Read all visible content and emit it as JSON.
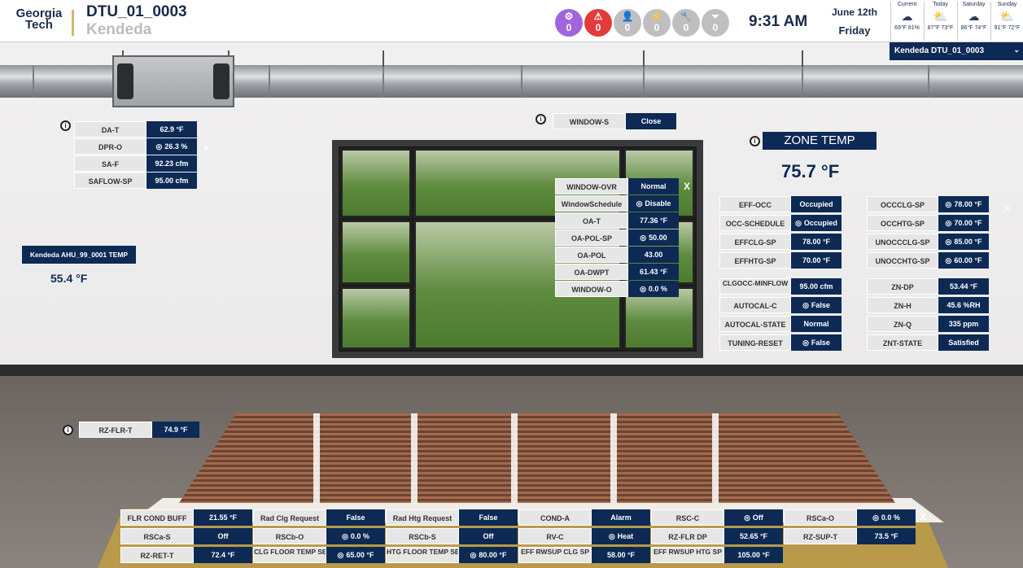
{
  "header": {
    "logo_line1": "Georgia",
    "logo_line2": "Tech",
    "title": "DTU_01_0003",
    "subtitle": "Kendeda",
    "time": "9:31 AM",
    "date": "June 12th",
    "day": "Friday",
    "status": [
      {
        "name": "settings-status",
        "count": "0",
        "color": "#a165d9",
        "icon": "⚙"
      },
      {
        "name": "alarm-status",
        "count": "0",
        "color": "#e33b3b",
        "icon": "⚠"
      },
      {
        "name": "occupancy-status",
        "count": "0",
        "color": "#bfbfbf",
        "icon": "👤"
      },
      {
        "name": "energy-status",
        "count": "0",
        "color": "#bfbfbf",
        "icon": "⚡"
      },
      {
        "name": "maintenance-status",
        "count": "0",
        "color": "#bfbfbf",
        "icon": "🔧"
      },
      {
        "name": "filter-status",
        "count": "0",
        "color": "#bfbfbf",
        "icon": "⏷"
      }
    ],
    "weather": [
      {
        "label": "Current",
        "icon": "☁",
        "temps": "69°F 81%"
      },
      {
        "label": "Today",
        "icon": "⛅",
        "temps": "87°F 73°F"
      },
      {
        "label": "Saturday",
        "icon": "☁",
        "temps": "86°F 74°F"
      },
      {
        "label": "Sunday",
        "icon": "⛅",
        "temps": "91°F 72°F"
      }
    ],
    "building_select": "Kendeda DTU_01_0003"
  },
  "supply": {
    "rows": [
      {
        "label": "DA-T",
        "value": "62.9 °F"
      },
      {
        "label": "DPR-O",
        "value": "26.3 %",
        "settable": true
      },
      {
        "label": "SA-F",
        "value": "92.23 cfm"
      },
      {
        "label": "SAFLOW-SP",
        "value": "95.00 cfm"
      }
    ],
    "close": "x"
  },
  "ahu": {
    "label": "Kendeda AHU_99_0001 TEMP",
    "value": "55.4 °F"
  },
  "window_s": {
    "label": "WINDOW-S",
    "value": "Close"
  },
  "window_panel": {
    "rows": [
      {
        "label": "WINDOW-OVR",
        "value": "Normal"
      },
      {
        "label": "WindowSchedule",
        "value": "Disable",
        "settable": true
      },
      {
        "label": "OA-T",
        "value": "77.36 °F"
      },
      {
        "label": "OA-POL-SP",
        "value": "50.00",
        "settable": true
      },
      {
        "label": "OA-POL",
        "value": "43.00"
      },
      {
        "label": "OA-DWPT",
        "value": "61.43 °F"
      },
      {
        "label": "WINDOW-O",
        "value": "0.0 %",
        "settable": true
      }
    ],
    "close": "X"
  },
  "zone": {
    "title": "ZONE TEMP",
    "value": "75.7 °F",
    "left": [
      {
        "label": "EFF-OCC",
        "value": "Occupied"
      },
      {
        "label": "OCC-SCHEDULE",
        "value": "Occupied",
        "settable": true
      },
      {
        "label": "EFFCLG-SP",
        "value": "78.00 °F"
      },
      {
        "label": "EFFHTG-SP",
        "value": "70.00 °F"
      },
      {
        "label": "CLGOCC-MINFLOW",
        "value": "95.00 cfm",
        "two": true
      },
      {
        "label": "AUTOCAL-C",
        "value": "False",
        "settable": true
      },
      {
        "label": "AUTOCAL-STATE",
        "value": "Normal"
      },
      {
        "label": "TUNING-RESET",
        "value": "False",
        "settable": true
      }
    ],
    "right": [
      {
        "label": "OCCCLG-SP",
        "value": "78.00 °F",
        "settable": true
      },
      {
        "label": "OCCHTG-SP",
        "value": "70.00 °F",
        "settable": true
      },
      {
        "label": "UNOCCCLG-SP",
        "value": "85.00 °F",
        "settable": true
      },
      {
        "label": "UNOCCHTG-SP",
        "value": "60.00 °F",
        "settable": true
      },
      {
        "label": "ZN-DP",
        "value": "53.44 °F"
      },
      {
        "label": "ZN-H",
        "value": "45.6 %RH"
      },
      {
        "label": "ZN-Q",
        "value": "335 ppm"
      },
      {
        "label": "ZNT-STATE",
        "value": "Satisfied"
      }
    ],
    "close": "x"
  },
  "radiant": {
    "label": "RZ-FLR-T",
    "value": "74.9 °F"
  },
  "bottom": {
    "rows": [
      [
        {
          "label": "FLR COND BUFF",
          "value": "21.55 °F"
        },
        {
          "label": "Rad Clg Request",
          "value": "False"
        },
        {
          "label": "Rad Htg Request",
          "value": "False"
        },
        {
          "label": "COND-A",
          "value": "Alarm"
        },
        {
          "label": "RSC-C",
          "value": "Off",
          "settable": true
        },
        {
          "label": "RSCa-O",
          "value": "0.0 %",
          "settable": true
        }
      ],
      [
        {
          "label": "RSCa-S",
          "value": "Off"
        },
        {
          "label": "RSCb-O",
          "value": "0.0 %",
          "settable": true
        },
        {
          "label": "RSCb-S",
          "value": "Off"
        },
        {
          "label": "RV-C",
          "value": "Heat",
          "settable": true
        },
        {
          "label": "RZ-FLR DP",
          "value": "52.65 °F"
        },
        {
          "label": "RZ-SUP-T",
          "value": "73.5 °F"
        }
      ],
      [
        {
          "label": "RZ-RET-T",
          "value": "72.4 °F"
        },
        {
          "label": "CLG FLOOR TEMP SETPOINT",
          "value": "65.00 °F",
          "settable": true,
          "two": true
        },
        {
          "label": "HTG FLOOR TEMP SETPOINT",
          "value": "80.00 °F",
          "settable": true,
          "two": true
        },
        {
          "label": "EFF RWSUP CLG SP",
          "value": "58.00 °F",
          "two": true
        },
        {
          "label": "EFF RWSUP HTG SP",
          "value": "105.00 °F",
          "two": true
        }
      ]
    ],
    "close": "X"
  },
  "info_icon": "i",
  "settable_glyph": "◎"
}
